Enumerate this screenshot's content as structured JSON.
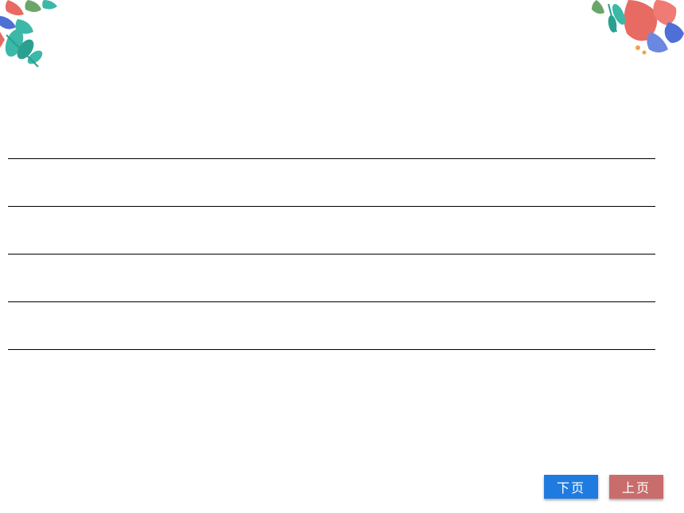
{
  "nav": {
    "next_label": "下页",
    "prev_label": "上页"
  },
  "decor": {
    "top_left_icon": "floral-leaves-tl",
    "top_right_icon": "floral-leaves-tr"
  },
  "lines": {
    "count": 5
  },
  "colors": {
    "next_button": "#1f7be0",
    "prev_button": "#c96c6c",
    "teal": "#3bb8a8",
    "coral": "#e86b63",
    "blue_leaf": "#4e6fd6",
    "green_leaf": "#6aa66a"
  }
}
